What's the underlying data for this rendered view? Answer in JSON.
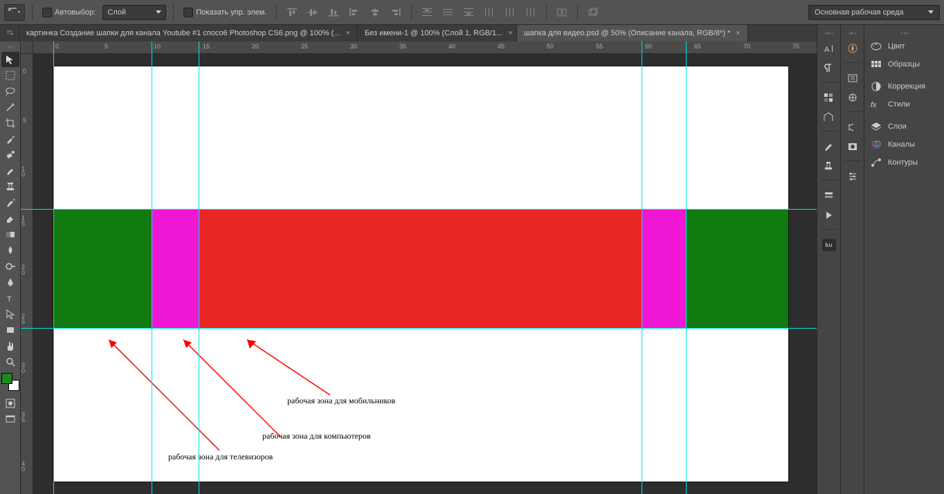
{
  "options_bar": {
    "auto_select_label": "Автовыбор:",
    "auto_select_target": "Слой",
    "show_controls_label": "Показать упр. элем."
  },
  "workspace": {
    "current": "Основная рабочая среда"
  },
  "tabs": [
    {
      "title": "картинка Создание шапки для канала Youtube #1 cпосо6 Photoshop CS6.png @ 100% (...",
      "active": false
    },
    {
      "title": "Без имени-1 @ 100% (Слой 1, RGB/1...",
      "active": false
    },
    {
      "title": "шапка для видео.psd @ 50% (Описание канала, RGB/8*) *",
      "active": true
    }
  ],
  "ruler_h": [
    "0",
    "5",
    "10",
    "15",
    "20",
    "25",
    "30",
    "35",
    "40",
    "45",
    "50",
    "55",
    "60",
    "65",
    "70",
    "75"
  ],
  "ruler_v": [
    "0",
    "5",
    "1 0",
    "1 5",
    "2 0",
    "2 5",
    "3 0",
    "3 5",
    "4 0"
  ],
  "annotations": {
    "mobile": "рабочая зона для мобильников",
    "computers": "рабочая зона для компьютеров",
    "tv": "рабочая зона для телевизоров"
  },
  "panels": [
    {
      "icon": "color",
      "label": "Цвет"
    },
    {
      "icon": "swatches",
      "label": "Образцы"
    },
    {
      "icon": "adjust",
      "label": "Коррекция"
    },
    {
      "icon": "styles",
      "label": "Стили"
    },
    {
      "icon": "layers",
      "label": "Слои"
    },
    {
      "icon": "channels",
      "label": "Каналы"
    },
    {
      "icon": "paths",
      "label": "Контуры"
    }
  ],
  "left_icon_col": [
    "text",
    "paragraph",
    "swatch-grid",
    "ruler",
    "brush",
    "clone",
    "history",
    "tools",
    "ku"
  ]
}
